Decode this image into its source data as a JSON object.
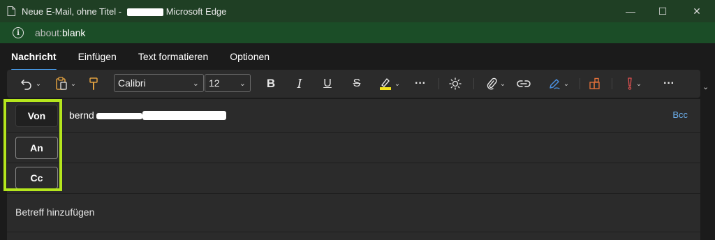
{
  "window": {
    "title_prefix": "Neue E-Mail, ohne Titel - ",
    "title_suffix": "Microsoft Edge",
    "minimize_glyph": "—",
    "maximize_glyph": "☐",
    "close_glyph": "✕"
  },
  "address": {
    "scheme": "about:",
    "host": "blank"
  },
  "ribbon": {
    "tabs": [
      {
        "label": "Nachricht"
      },
      {
        "label": "Einfügen"
      },
      {
        "label": "Text formatieren"
      },
      {
        "label": "Optionen"
      }
    ]
  },
  "toolbar": {
    "font": "Calibri",
    "font_size": "12",
    "bold_glyph": "B",
    "italic_glyph": "I",
    "underline_glyph": "U",
    "strike_glyph": "S",
    "more_glyph": "···",
    "highlight_color": "#f2e21c",
    "pen_color": "#4a8fe0",
    "grid_color": "#e0703a",
    "importance_color": "#e05050"
  },
  "compose": {
    "from_label": "Von",
    "to_label": "An",
    "cc_label": "Cc",
    "from_value_visible": "bernd",
    "bcc_label": "Bcc",
    "subject_placeholder": "Betreff hinzufügen"
  },
  "colors": {
    "titlebar": "#1f3f24",
    "addressbar": "#1b4d27",
    "accent": "#4aa0f0",
    "highlight_box": "#b5e61d"
  }
}
